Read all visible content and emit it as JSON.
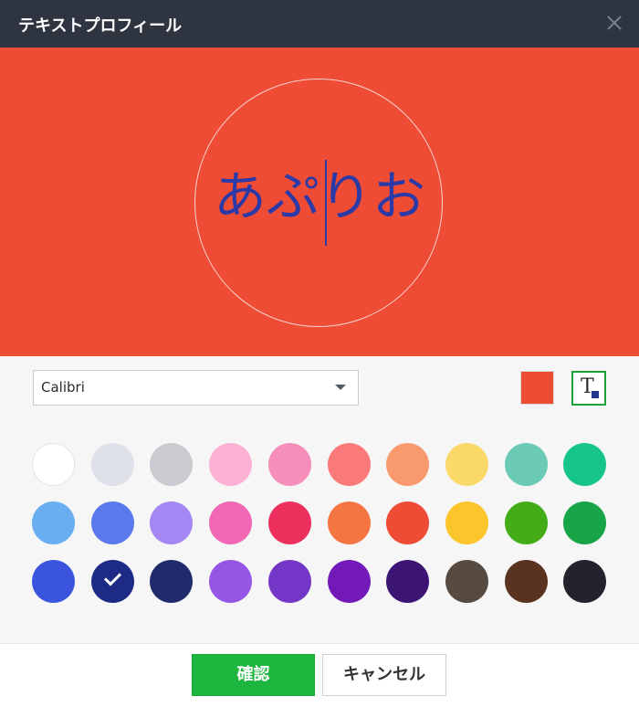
{
  "window": {
    "title": "テキストプロフィール"
  },
  "preview": {
    "text": "あぷりお",
    "background_color": "#ee4c35",
    "text_color": "#2c3aa8"
  },
  "controls": {
    "font": {
      "selected": "Calibri"
    },
    "background_color": "#ee4c35",
    "text_color_icon": "text-color-icon"
  },
  "palette": {
    "selected_index": 21,
    "colors": [
      "#ffffff",
      "#dfe1e8",
      "#c9cbd0",
      "#fdb1d3",
      "#f58fba",
      "#f97a78",
      "#f99a6e",
      "#fbd968",
      "#6bcab5",
      "#17c58b",
      "#69aef0",
      "#5a79ec",
      "#a587f4",
      "#f267b3",
      "#ec2f5d",
      "#f57542",
      "#ee4c35",
      "#fbc52b",
      "#44ac17",
      "#17a547",
      "#3a54dd",
      "#1d2a86",
      "#1f2b6a",
      "#9556e5",
      "#7436c6",
      "#7219b8",
      "#3c1474",
      "#574a41",
      "#59331f",
      "#22232c"
    ]
  },
  "footer": {
    "confirm_label": "確認",
    "cancel_label": "キャンセル"
  }
}
